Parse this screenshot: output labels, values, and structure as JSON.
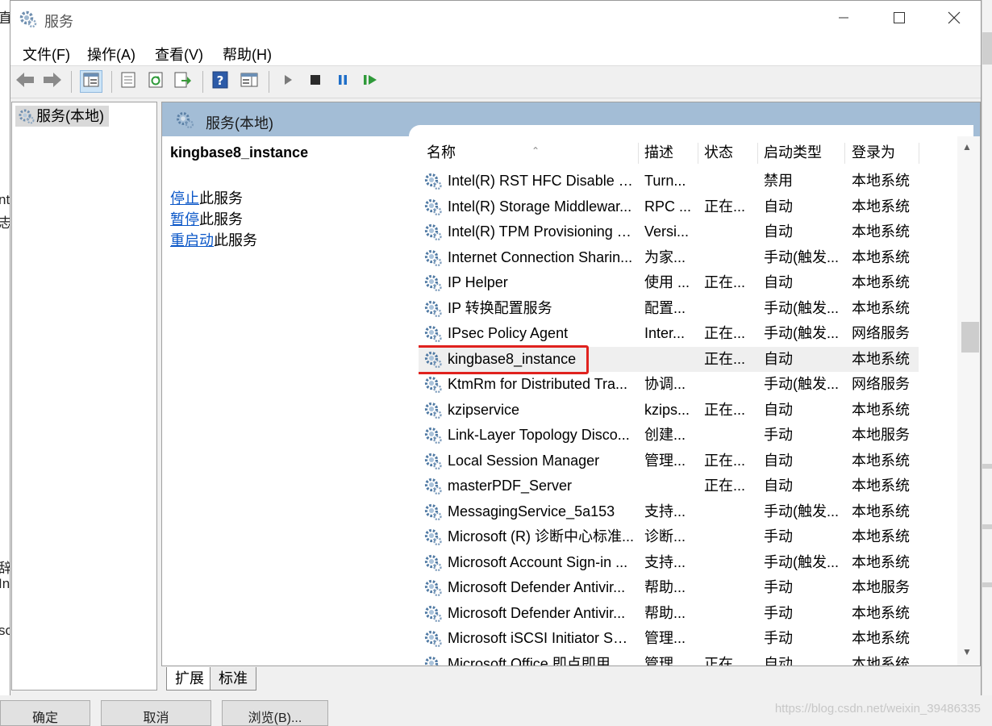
{
  "window": {
    "title": "服务",
    "controls": [
      "minimize-icon",
      "maximize-icon",
      "close-icon"
    ]
  },
  "menubar": [
    "文件(F)",
    "操作(A)",
    "查看(V)",
    "帮助(H)"
  ],
  "toolbar": {
    "icons": [
      "back-arrow-icon",
      "forward-arrow-icon",
      "console-tree-icon",
      "properties-icon",
      "refresh-icon",
      "export-list-icon",
      "help-icon",
      "show-hide-action-pane-icon",
      "start-service-icon",
      "stop-service-icon",
      "pause-service-icon",
      "restart-service-icon"
    ]
  },
  "tree": {
    "root_label": "服务(本地)"
  },
  "panel": {
    "header_title": "服务(本地)",
    "selected_name": "kingbase8_instance",
    "actions": [
      {
        "link": "停止",
        "rest": "此服务"
      },
      {
        "link": "暂停",
        "rest": "此服务"
      },
      {
        "link": "重启动",
        "rest": "此服务"
      }
    ]
  },
  "table": {
    "columns": [
      "名称",
      "描述",
      "状态",
      "启动类型",
      "登录为"
    ],
    "rows": [
      {
        "name": "Intel(R) RST HFC Disable S...",
        "desc": "Turn...",
        "status": "",
        "startup": "禁用",
        "logon": "本地系统"
      },
      {
        "name": "Intel(R) Storage Middlewar...",
        "desc": "RPC ...",
        "status": "正在...",
        "startup": "自动",
        "logon": "本地系统"
      },
      {
        "name": "Intel(R) TPM Provisioning S...",
        "desc": "Versi...",
        "status": "",
        "startup": "自动",
        "logon": "本地系统"
      },
      {
        "name": "Internet Connection Sharin...",
        "desc": "为家...",
        "status": "",
        "startup": "手动(触发...",
        "logon": "本地系统"
      },
      {
        "name": "IP Helper",
        "desc": "使用 ...",
        "status": "正在...",
        "startup": "自动",
        "logon": "本地系统"
      },
      {
        "name": "IP 转换配置服务",
        "desc": "配置...",
        "status": "",
        "startup": "手动(触发...",
        "logon": "本地系统"
      },
      {
        "name": "IPsec Policy Agent",
        "desc": "Inter...",
        "status": "正在...",
        "startup": "手动(触发...",
        "logon": "网络服务"
      },
      {
        "name": "kingbase8_instance",
        "desc": "",
        "status": "正在...",
        "startup": "自动",
        "logon": "本地系统",
        "selected": true
      },
      {
        "name": "KtmRm for Distributed Tra...",
        "desc": "协调...",
        "status": "",
        "startup": "手动(触发...",
        "logon": "网络服务"
      },
      {
        "name": "kzipservice",
        "desc": "kzips...",
        "status": "正在...",
        "startup": "自动",
        "logon": "本地系统"
      },
      {
        "name": "Link-Layer Topology Disco...",
        "desc": "创建...",
        "status": "",
        "startup": "手动",
        "logon": "本地服务"
      },
      {
        "name": "Local Session Manager",
        "desc": "管理...",
        "status": "正在...",
        "startup": "自动",
        "logon": "本地系统"
      },
      {
        "name": "masterPDF_Server",
        "desc": "",
        "status": "正在...",
        "startup": "自动",
        "logon": "本地系统"
      },
      {
        "name": "MessagingService_5a153",
        "desc": "支持...",
        "status": "",
        "startup": "手动(触发...",
        "logon": "本地系统"
      },
      {
        "name": "Microsoft (R) 诊断中心标准...",
        "desc": "诊断...",
        "status": "",
        "startup": "手动",
        "logon": "本地系统"
      },
      {
        "name": "Microsoft Account Sign-in ...",
        "desc": "支持...",
        "status": "",
        "startup": "手动(触发...",
        "logon": "本地系统"
      },
      {
        "name": "Microsoft Defender Antivir...",
        "desc": "帮助...",
        "status": "",
        "startup": "手动",
        "logon": "本地服务"
      },
      {
        "name": "Microsoft Defender Antivir...",
        "desc": "帮助...",
        "status": "",
        "startup": "手动",
        "logon": "本地系统"
      },
      {
        "name": "Microsoft iSCSI Initiator Ser...",
        "desc": "管理...",
        "status": "",
        "startup": "手动",
        "logon": "本地系统"
      },
      {
        "name": "Microsoft Office 即点即用...",
        "desc": "管理...",
        "status": "正在...",
        "startup": "自动",
        "logon": "本地系统"
      }
    ]
  },
  "tabs": [
    "扩展",
    "标准"
  ],
  "background": {
    "left_fragments": [
      "直",
      "nt",
      "志",
      "辞",
      "In",
      "sc"
    ],
    "bottom_buttons": [
      "确定",
      "取消",
      "浏览(B)..."
    ],
    "watermark": "https://blog.csdn.net/weixin_39486335"
  },
  "colors": {
    "panel_header": "#a3bdd6",
    "highlight_box": "#e0221e",
    "link": "#0b57c8"
  }
}
